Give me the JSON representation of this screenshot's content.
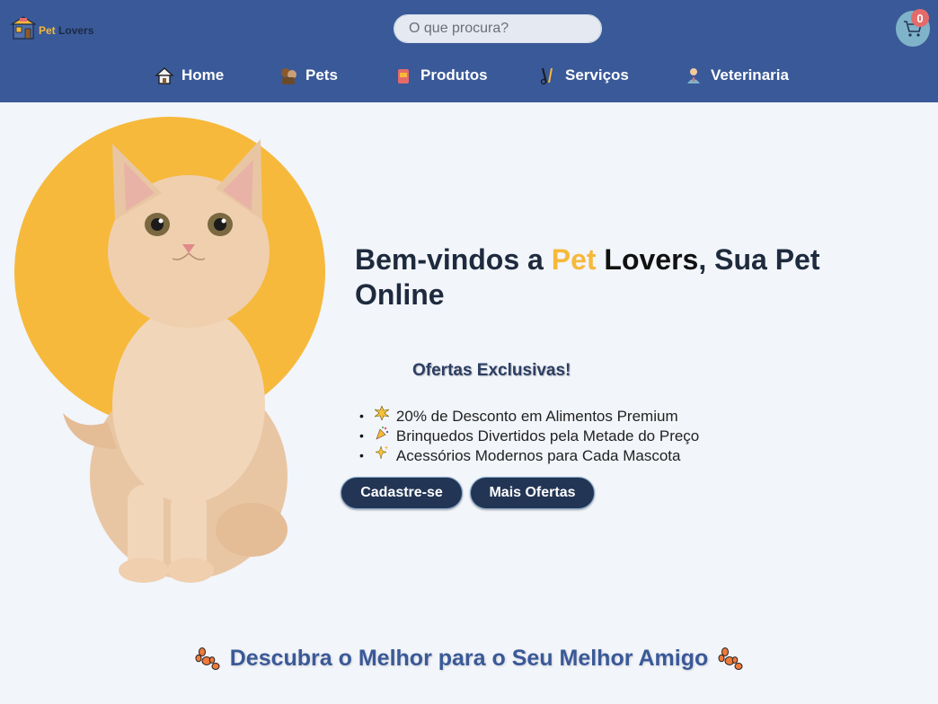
{
  "header": {
    "logo": {
      "part1": "Pet",
      "part2": "Lovers"
    },
    "search": {
      "placeholder": "O que procura?"
    },
    "cart": {
      "count": "0"
    },
    "nav": [
      {
        "label": "Home",
        "icon": "house-icon"
      },
      {
        "label": "Pets",
        "icon": "pets-icon"
      },
      {
        "label": "Produtos",
        "icon": "pet-food-icon"
      },
      {
        "label": "Serviços",
        "icon": "grooming-tools-icon"
      },
      {
        "label": "Veterinaria",
        "icon": "veterinarian-icon"
      }
    ]
  },
  "hero": {
    "title_part1": "Bem-vindos a ",
    "title_pet": "Pet",
    "title_lovers": "Lovers",
    "title_part2": ", Sua Pet Online",
    "offers_title": "Ofertas Exclusivas!",
    "offers": [
      {
        "icon": "sparkle-burst-icon",
        "text": "20% de Desconto em Alimentos Premium"
      },
      {
        "icon": "party-popper-icon",
        "text": "Brinquedos Divertidos pela Metade do Preço"
      },
      {
        "icon": "sparkles-icon",
        "text": "Acessórios Modernos para Cada Mascota"
      }
    ],
    "buttons": {
      "signup": "Cadastre-se",
      "more": "Mais Ofertas"
    }
  },
  "discover": {
    "text": "Descubra o Melhor para o Seu Melhor Amigo"
  },
  "colors": {
    "header": "#3a5998",
    "accent": "#f6b93b",
    "button": "#233554",
    "cart_badge": "#e56b6b"
  }
}
